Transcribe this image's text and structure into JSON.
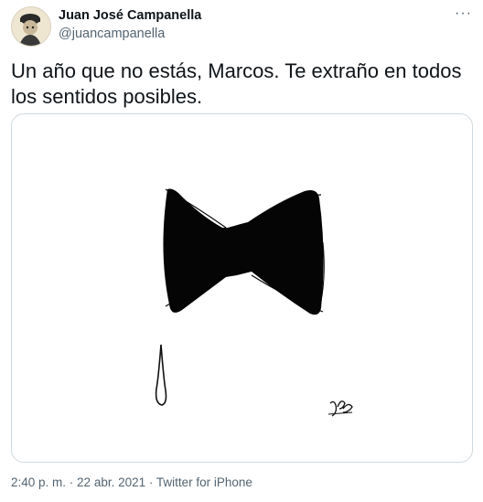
{
  "author": {
    "name": "Juan José Campanella",
    "handle": "@juancampanella"
  },
  "tweet": {
    "text": "Un año que no estás, Marcos. Te extraño en todos los sentidos posibles."
  },
  "menu": {
    "icon": "more-options-icon",
    "label": "···"
  },
  "meta": {
    "time": "2:40 p. m.",
    "sep1": " · ",
    "date": "22 abr. 2021",
    "sep2": " · ",
    "source": "Twitter for iPhone"
  }
}
